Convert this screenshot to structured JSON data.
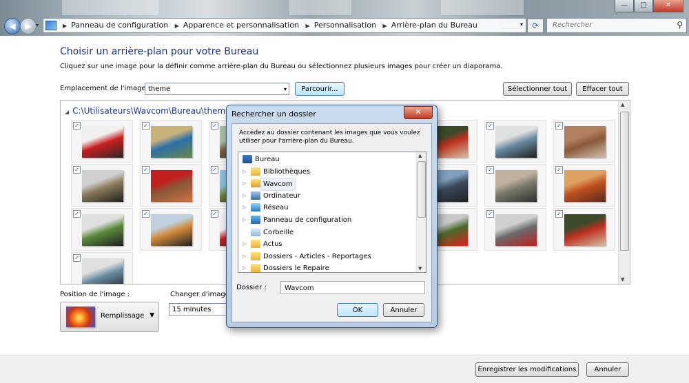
{
  "window": {
    "minimize_glyph": "—",
    "maximize_glyph": "□",
    "close_glyph": "✕"
  },
  "nav": {
    "back_glyph": "◀",
    "forward_glyph": "▶",
    "dropdown_glyph": "▾",
    "breadcrumbs": [
      "Panneau de configuration",
      "Apparence et personnalisation",
      "Personnalisation",
      "Arrière-plan du Bureau"
    ],
    "separator": "▶",
    "refresh_glyph": "⟳",
    "search_placeholder": "Rechercher",
    "search_icon": "magnifier-icon"
  },
  "main": {
    "title": "Choisir un arrière-plan pour votre Bureau",
    "description": "Cliquez sur une image pour la définir comme arrière-plan du Bureau ou sélectionnez plusieurs images pour créer un diaporama.",
    "location_label": "Emplacement de l'image :",
    "location_value": "theme",
    "browse_button": "Parcourir...",
    "select_all_button": "Sélectionner tout",
    "clear_all_button": "Effacer tout",
    "folder_path": "C:\\Utilisateurs\\Wavcom\\Bureau\\theme (",
    "checkmark": "✓",
    "position_label": "Position de l'image :",
    "position_value": "Remplissage",
    "change_label": "Changer d'image t",
    "change_value": "15 minutes",
    "save_button": "Enregistrer les modifications",
    "cancel_button": "Annuler"
  },
  "tiles": {
    "colors": [
      [
        "#c81e1e",
        "#f0f0f0",
        "#2a2a2a"
      ],
      [
        "#2c6fa8",
        "#c9b27a",
        "#6a8a4a"
      ],
      [
        "#7a5a3a",
        "#a4c0a0",
        "#3a3a3a"
      ],
      [
        "#4a6a2a",
        "#c8c8c8",
        "#e02020"
      ],
      [
        "#6a6a6a",
        "#d0d0d0",
        "#c02020"
      ],
      [
        "#c03020",
        "#3a4a2a",
        "#d0c0a0"
      ],
      [
        "#6a8aa0",
        "#e0e0e0",
        "#202020"
      ],
      [
        "#8a5a3a",
        "#b08060",
        "#d0c0b0"
      ],
      [
        "#8a7a5a",
        "#d0d0d0",
        "#202020"
      ],
      [
        "#8a5a3a",
        "#c02020",
        "#d07040"
      ],
      [
        "#6a8a3a",
        "#8ac0e0",
        "#202020"
      ],
      [
        "#8a7060",
        "#c02020",
        "#f0f0f0"
      ],
      [
        "#d02030",
        "#b08080",
        "#f0f0f0"
      ],
      [
        "#3a4a5a",
        "#80a0c0",
        "#202020"
      ],
      [
        "#7a7a6a",
        "#c0b0a0",
        "#303030"
      ],
      [
        "#c05020",
        "#e0a060",
        "#5a2a1a"
      ],
      [
        "#5a8a3a",
        "#e0e0e0",
        "#202020"
      ],
      [
        "#d08a3a",
        "#c0d0e0",
        "#202020"
      ]
    ]
  },
  "dialog": {
    "title": "Rechercher un dossier",
    "close_glyph": "✕",
    "instruction": "Accédez au dossier contenant les images que vous voulez utiliser pour l'arrière-plan du Bureau.",
    "tree": [
      {
        "label": "Bureau",
        "icon": "desktop-icon"
      },
      {
        "label": "Bibliothèques",
        "icon": "folder-icon"
      },
      {
        "label": "Wavcom",
        "icon": "user-folder-icon",
        "selected": true
      },
      {
        "label": "Ordinateur",
        "icon": "computer-icon"
      },
      {
        "label": "Réseau",
        "icon": "network-icon"
      },
      {
        "label": "Panneau de configuration",
        "icon": "control-panel-icon"
      },
      {
        "label": "Corbeille",
        "icon": "recycle-bin-icon"
      },
      {
        "label": "Actus",
        "icon": "folder-icon"
      },
      {
        "label": "Dossiers - Articles - Reportages",
        "icon": "folder-icon"
      },
      {
        "label": "Dossiers le Repaire",
        "icon": "folder-icon"
      }
    ],
    "expand_glyph": "▷",
    "folder_label": "Dossier :",
    "folder_value": "Wavcom",
    "ok_button": "OK",
    "cancel_button": "Annuler"
  }
}
